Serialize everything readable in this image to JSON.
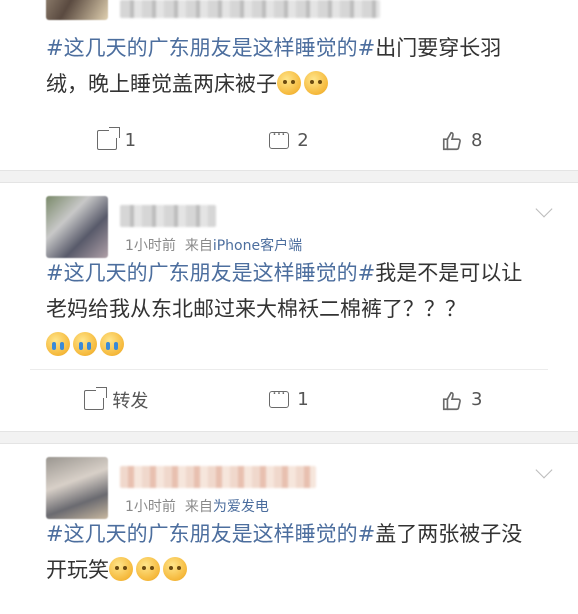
{
  "posts": [
    {
      "text_tag": "#这几天的广东朋友是这样睡觉的#",
      "text_body": "出门要穿长羽绒，晚上睡觉盖两床被子",
      "actions": {
        "share": "1",
        "comment": "2",
        "like": "8"
      }
    },
    {
      "time": "1小时前",
      "source_prefix": "来自",
      "source": "iPhone客户端",
      "text_tag": "#这几天的广东朋友是这样睡觉的#",
      "text_body": "我是不是可以让老妈给我从东北邮过来大棉袄二棉裤了？？？",
      "actions": {
        "share": "转发",
        "comment": "1",
        "like": "3"
      }
    },
    {
      "time": "1小时前",
      "source_prefix": "来自",
      "source": "为爱发电",
      "text_tag": "#这几天的广东朋友是这样睡觉的#",
      "text_body": "盖了两张被子没开玩笑"
    }
  ],
  "icons": {
    "share": "share-icon",
    "comment": "comment-icon",
    "like": "thumbs-up-icon",
    "more": "chevron-down-icon"
  },
  "colors": {
    "link": "#4c6e9e",
    "meta": "#8a8a8a",
    "separator": "#f2f2f2"
  }
}
